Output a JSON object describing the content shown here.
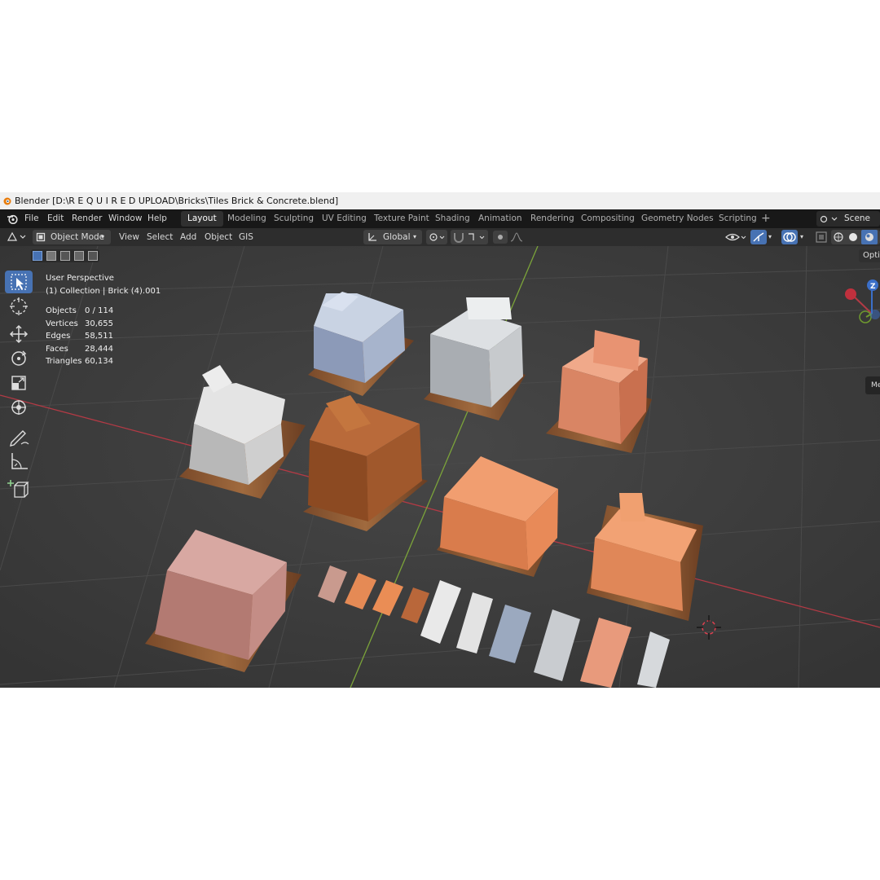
{
  "window": {
    "title": "Blender [D:\\R E Q U I R E D   UPLOAD\\Bricks\\Tiles Brick & Concrete.blend]"
  },
  "menu": [
    "File",
    "Edit",
    "Render",
    "Window",
    "Help"
  ],
  "workspaces": [
    "Layout",
    "Modeling",
    "Sculpting",
    "UV Editing",
    "Texture Paint",
    "Shading",
    "Animation",
    "Rendering",
    "Compositing",
    "Geometry Nodes",
    "Scripting"
  ],
  "active_workspace": "Layout",
  "scene": {
    "label": "Scene"
  },
  "header": {
    "mode": "Object Mode",
    "menus": [
      "View",
      "Select",
      "Add",
      "Object",
      "GIS"
    ],
    "orientation": "Global",
    "options_label": "Optio",
    "n_panel_tab": "Me"
  },
  "viewport": {
    "view_name": "User Perspective",
    "collection": "(1) Collection | Brick  (4).001",
    "stats": [
      {
        "label": "Objects",
        "value": "0 / 114"
      },
      {
        "label": "Vertices",
        "value": "30,655"
      },
      {
        "label": "Edges",
        "value": "58,511"
      },
      {
        "label": "Faces",
        "value": "28,444"
      },
      {
        "label": "Triangles",
        "value": "60,134"
      }
    ]
  },
  "tools": [
    "select-box-icon",
    "cursor-icon",
    "move-icon",
    "rotate-icon",
    "scale-icon",
    "transform-icon",
    "annotate-icon",
    "measure-icon",
    "add-cube-icon"
  ],
  "colors": {
    "accent": "#4772b3",
    "viewport_bg": "#3d3d3d",
    "x_axis": "#b33a45",
    "y_axis": "#7ba33a"
  }
}
